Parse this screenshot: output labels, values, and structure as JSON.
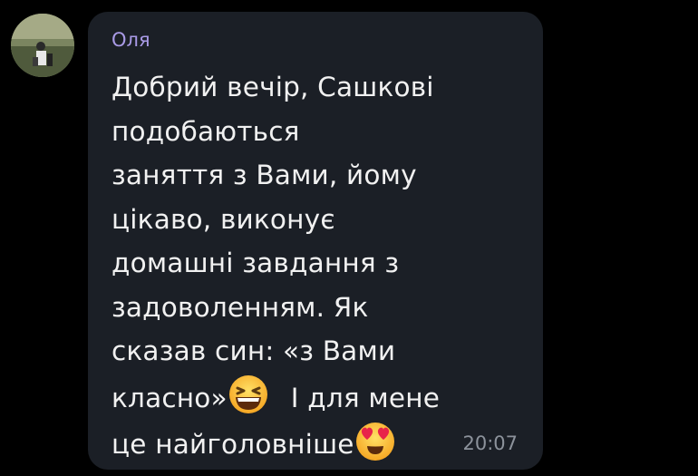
{
  "message": {
    "sender": "Оля",
    "lines": [
      "Добрий вечір, Сашкові",
      "подобаються",
      "заняття з Вами, йому",
      "цікаво, виконує",
      "домашні завдання з",
      "задоволенням. Як",
      "сказав син: «з Вами"
    ],
    "line8_text_a": "класно»",
    "line8_text_b": "І для мене",
    "line9_text": "це найголовніше",
    "emoji_1": "grinning-squinting-face-icon",
    "emoji_2": "heart-eyes-face-icon",
    "time": "20:07"
  },
  "colors": {
    "background": "#000000",
    "bubble": "#1b1f26",
    "sender": "#a99ae6",
    "text": "#f1f1f1",
    "time": "#8c929b"
  }
}
